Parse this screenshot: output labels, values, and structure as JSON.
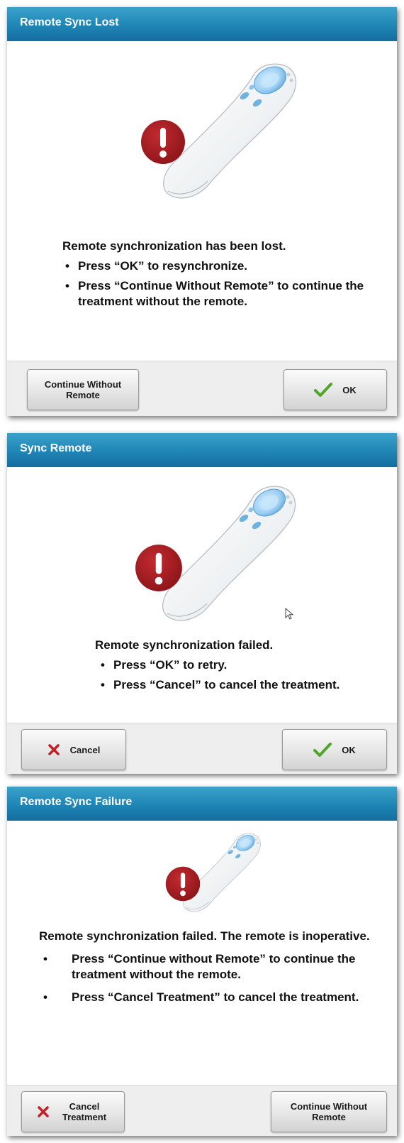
{
  "colors": {
    "titlebar": "#1f85b6",
    "alert_circle": "#9e1b21",
    "check": "#4fa628",
    "cross": "#c21f26"
  },
  "dialogs": [
    {
      "title": "Remote Sync Lost",
      "icons": [
        "remote-control-illustration",
        "alert-icon"
      ],
      "message": "Remote synchronization has been lost.",
      "bullets": [
        "Press “OK” to resynchronize.",
        "Press “Continue Without Remote” to continue the treatment without the remote."
      ],
      "buttons": {
        "left": {
          "label": "Continue Without Remote",
          "icon": ""
        },
        "right": {
          "label": "OK",
          "icon": "check-icon"
        }
      }
    },
    {
      "title": "Sync Remote",
      "icons": [
        "remote-control-illustration",
        "alert-icon",
        "mouse-cursor-icon"
      ],
      "message": "Remote synchronization failed.",
      "bullets": [
        "Press “OK” to retry.",
        "Press “Cancel” to cancel the treatment."
      ],
      "buttons": {
        "left": {
          "label": "Cancel",
          "icon": "close-icon"
        },
        "right": {
          "label": "OK",
          "icon": "check-icon"
        }
      }
    },
    {
      "title": "Remote Sync Failure",
      "icons": [
        "remote-control-illustration",
        "alert-icon"
      ],
      "message": "Remote synchronization failed.  The remote is inoperative.",
      "bullets": [
        "Press “Continue without Remote” to continue the treatment without the remote.",
        "Press “Cancel Treatment” to cancel the treatment."
      ],
      "buttons": {
        "left": {
          "label": "Cancel Treatment",
          "icon": "close-icon"
        },
        "right": {
          "label": "Continue Without Remote",
          "icon": ""
        }
      }
    }
  ]
}
